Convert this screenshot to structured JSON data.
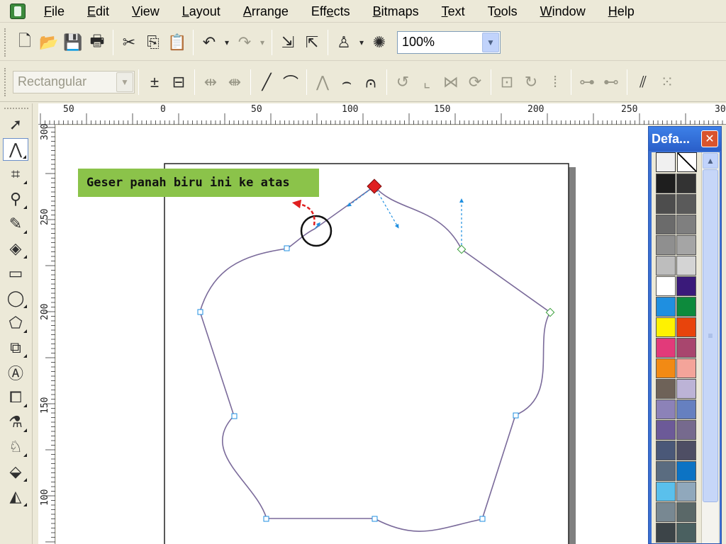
{
  "menu": {
    "items": [
      {
        "pre": "",
        "ul": "F",
        "post": "ile"
      },
      {
        "pre": "",
        "ul": "E",
        "post": "dit"
      },
      {
        "pre": "",
        "ul": "V",
        "post": "iew"
      },
      {
        "pre": "",
        "ul": "L",
        "post": "ayout"
      },
      {
        "pre": "",
        "ul": "A",
        "post": "rrange"
      },
      {
        "pre": "Eff",
        "ul": "e",
        "post": "cts"
      },
      {
        "pre": "",
        "ul": "B",
        "post": "itmaps"
      },
      {
        "pre": "",
        "ul": "T",
        "post": "ext"
      },
      {
        "pre": "T",
        "ul": "o",
        "post": "ols"
      },
      {
        "pre": "",
        "ul": "W",
        "post": "indow"
      },
      {
        "pre": "",
        "ul": "H",
        "post": "elp"
      }
    ]
  },
  "toolbar": {
    "zoom_value": "100%"
  },
  "property_bar": {
    "node_mode": "Rectangular"
  },
  "rulers": {
    "top_labels": [
      "50",
      "0",
      "50",
      "100",
      "150",
      "200",
      "250",
      "30"
    ],
    "left_labels": [
      "300",
      "250",
      "200",
      "150",
      "100"
    ]
  },
  "palette": {
    "title": "Defa...",
    "close": "✕",
    "colors": [
      "#1e1e1e",
      "#333333",
      "#4d4d4d",
      "#5a5a5a",
      "#6b6b6b",
      "#7f7f7f",
      "#8f8f8f",
      "#a5a5a5",
      "#bdbdbd",
      "#d4d4d4",
      "#ffffff",
      "#3a1a7a",
      "#1f8fe0",
      "#0d8a3c",
      "#fff200",
      "#e8440c",
      "#e23a7a",
      "#a8466e",
      "#f28a14",
      "#f4a49a",
      "#6e6258",
      "#bcb3d6",
      "#8c82b8",
      "#6680c0",
      "#6c5a98",
      "#766a8e",
      "#4a5878",
      "#4e4e64",
      "#5a6c80",
      "#0c73c4",
      "#5ac0ec",
      "#90a8bc",
      "#788892",
      "#5a6868",
      "#3c4448",
      "#4a6060"
    ]
  },
  "annotation": {
    "text": "Geser panah biru ini ke atas"
  },
  "colors": {
    "accent_blue": "#1f8fe0",
    "node_red": "#e02020",
    "callout_green": "#8bc34a",
    "arrow_red": "#e02020"
  }
}
